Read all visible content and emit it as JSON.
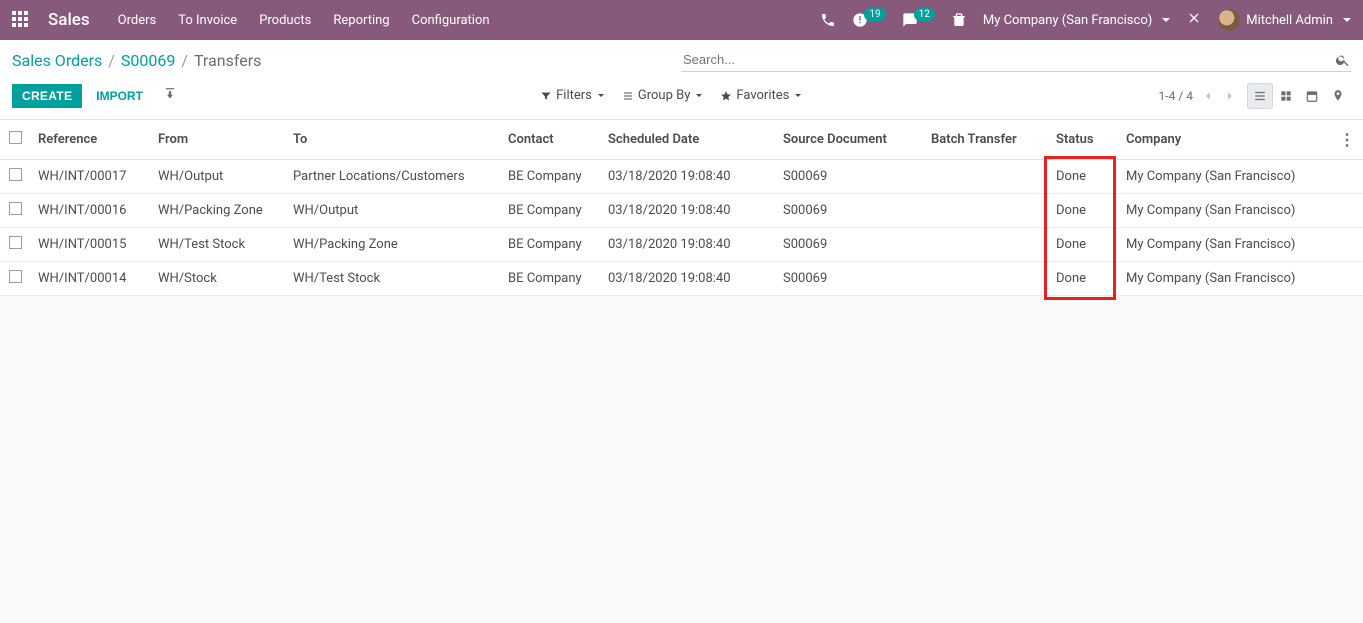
{
  "header": {
    "brand": "Sales",
    "menu": [
      "Orders",
      "To Invoice",
      "Products",
      "Reporting",
      "Configuration"
    ],
    "activities_badge": "19",
    "discuss_badge": "12",
    "company": "My Company (San Francisco)",
    "user": "Mitchell Admin"
  },
  "breadcrumb": {
    "l0": "Sales Orders",
    "l1": "S00069",
    "l2": "Transfers"
  },
  "search": {
    "placeholder": "Search..."
  },
  "buttons": {
    "create": "CREATE",
    "import": "IMPORT"
  },
  "filters": {
    "filters": "Filters",
    "group_by": "Group By",
    "favorites": "Favorites"
  },
  "pager": {
    "text": "1-4 / 4"
  },
  "columns": {
    "reference": "Reference",
    "from": "From",
    "to": "To",
    "contact": "Contact",
    "scheduled": "Scheduled Date",
    "source": "Source Document",
    "batch": "Batch Transfer",
    "status": "Status",
    "company": "Company"
  },
  "rows": [
    {
      "reference": "WH/INT/00017",
      "from": "WH/Output",
      "to": "Partner Locations/Customers",
      "contact": "BE Company",
      "scheduled": "03/18/2020 19:08:40",
      "source": "S00069",
      "batch": "",
      "status": "Done",
      "company": "My Company (San Francisco)"
    },
    {
      "reference": "WH/INT/00016",
      "from": "WH/Packing Zone",
      "to": "WH/Output",
      "contact": "BE Company",
      "scheduled": "03/18/2020 19:08:40",
      "source": "S00069",
      "batch": "",
      "status": "Done",
      "company": "My Company (San Francisco)"
    },
    {
      "reference": "WH/INT/00015",
      "from": "WH/Test Stock",
      "to": "WH/Packing Zone",
      "contact": "BE Company",
      "scheduled": "03/18/2020 19:08:40",
      "source": "S00069",
      "batch": "",
      "status": "Done",
      "company": "My Company (San Francisco)"
    },
    {
      "reference": "WH/INT/00014",
      "from": "WH/Stock",
      "to": "WH/Test Stock",
      "contact": "BE Company",
      "scheduled": "03/18/2020 19:08:40",
      "source": "S00069",
      "batch": "",
      "status": "Done",
      "company": "My Company (San Francisco)"
    }
  ]
}
